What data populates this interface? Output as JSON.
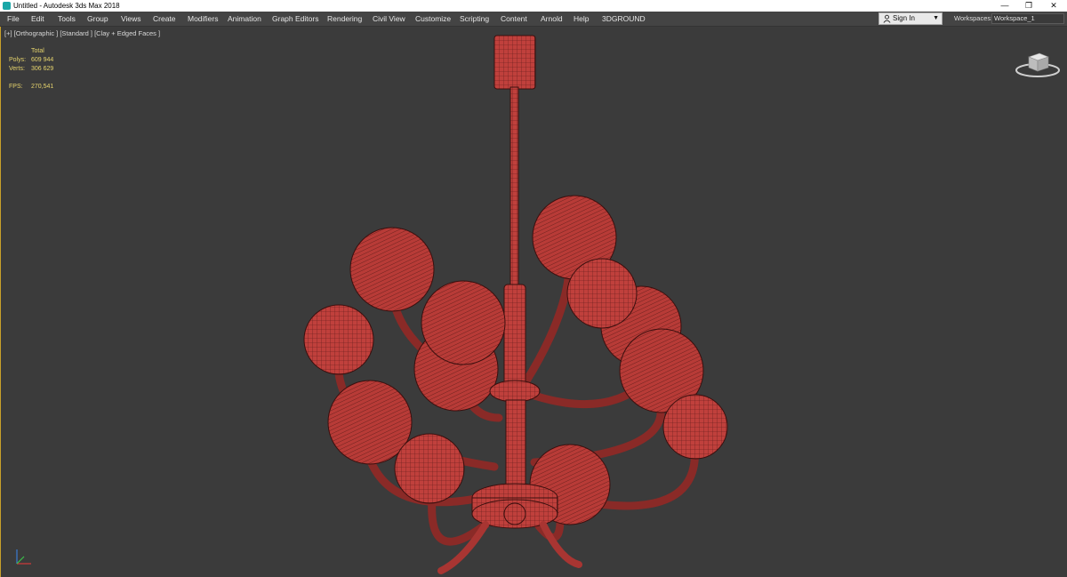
{
  "window": {
    "title": "Untitled - Autodesk 3ds Max 2018",
    "app_icon": "3ds-max-icon",
    "controls": {
      "minimize": "—",
      "restore": "❐",
      "close": "✕"
    }
  },
  "menu": {
    "items": [
      "File",
      "Edit",
      "Tools",
      "Group",
      "Views",
      "Create",
      "Modifiers",
      "Animation",
      "Graph Editors",
      "Rendering",
      "Civil View",
      "Customize",
      "Scripting",
      "Content",
      "Arnold",
      "Help",
      "3DGROUND"
    ],
    "sign_in": "Sign In",
    "workspaces_label": "Workspaces:",
    "workspace_value": "Workspace_1"
  },
  "viewport": {
    "label": "[+] [Orthographic ] [Standard ] [Clay + Edged Faces ]",
    "stats": {
      "total_label": "Total",
      "polys_label": "Polys:",
      "polys_value": "609 944",
      "verts_label": "Verts:",
      "verts_value": "306 629",
      "fps_label": "FPS:",
      "fps_value": "270,541"
    },
    "model_color": "#c0403c",
    "background_color": "#3b3b3b"
  }
}
